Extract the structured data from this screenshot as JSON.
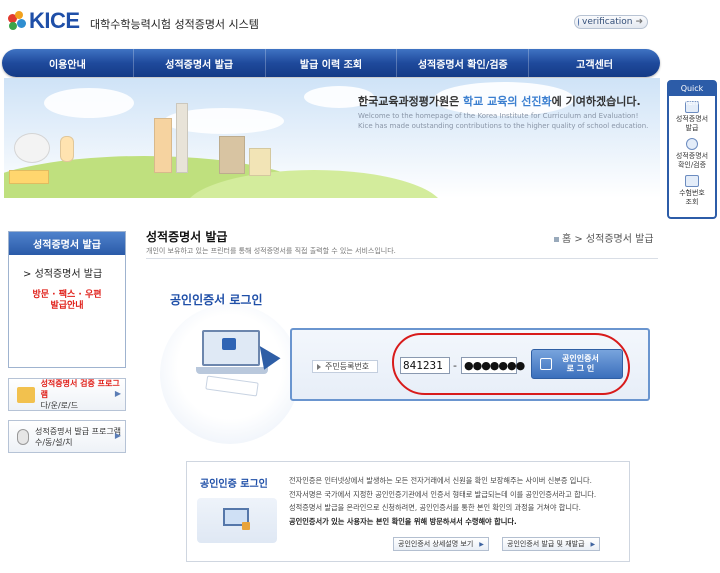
{
  "header": {
    "logo_text": "KICE",
    "system_title": "대학수학능력시험 성적증명서 시스템",
    "verification_label": "verification"
  },
  "nav": {
    "items": [
      {
        "label": "이용안내"
      },
      {
        "label": "성적증명서 발급"
      },
      {
        "label": "발급 이력 조회"
      },
      {
        "label": "성적증명서 확인/검증"
      },
      {
        "label": "고객센터"
      }
    ]
  },
  "banner": {
    "slogan_prefix": "한국교육과정평가원은",
    "slogan_highlight": "학교 교육의 선진화",
    "slogan_suffix": "에 기여하겠습니다.",
    "slogan_en_line1": "Welcome to the homepage of the Korea Institute for Curriculum and Evaluation!",
    "slogan_en_line2": "Kice has made outstanding contributions to the higher quality of school education."
  },
  "quick_menu": {
    "title": "Quick Menu",
    "items": [
      {
        "line1": "성적증명서",
        "line2": "발급"
      },
      {
        "line1": "성적증명서",
        "line2": "확인/검증"
      },
      {
        "line1": "수험번호",
        "line2": "조회"
      }
    ]
  },
  "sidebar": {
    "header": "성적증명서 발급",
    "item": "성적증명서 발급",
    "sub_line1": "방문 · 팩스 · 우편",
    "sub_line2": "발급안내",
    "buttons": [
      {
        "title": "성적증명서 검증 프로그램",
        "subtitle": "다/운/로/드"
      },
      {
        "title": "성적증명서 발급 프로그램",
        "subtitle": "수/동/설/치"
      }
    ]
  },
  "content": {
    "page_title": "성적증명서 발급",
    "page_desc": "개인이 보유하고 있는 프린터를 통해 성적증명서를 직접 출력할 수 있는 서비스입니다.",
    "breadcrumb": "홈 > 성적증명서 발급"
  },
  "login": {
    "title": "공인인증서 로그인",
    "id_label": "주민등록번호",
    "id_front_value": "841231",
    "id_back_value": "●●●●●●●",
    "button_line1": "공인인증서",
    "button_line2": "로 그 인"
  },
  "info": {
    "title": "공인인증 로그인",
    "lines": [
      "전자인증은 인터넷상에서 발생하는 모든 전자거래에서 신원을 확인 보장해주는 사이버 신분증 입니다.",
      "전자서명은 국가에서 지정한 공인인증기관에서 인증서 형태로 발급되는데 이를 공인인증서라고 합니다.",
      "성적증명서 발급을 온라인으로 신청하려면, 공인인증서를 통한 본인 확인의 과정을 거쳐야 합니다.",
      "공인인증서가 있는 사용자는 본인 확인을 위해 방문하셔서 수령해야 합니다."
    ],
    "button_detail": "공인인증서 상세설명 보기",
    "button_issue": "공인인증서 발급 및 재발급"
  },
  "colors": {
    "brand_blue": "#1f4fa8",
    "nav_blue": "#1f4a9c",
    "alert_red": "#d81b1b"
  }
}
